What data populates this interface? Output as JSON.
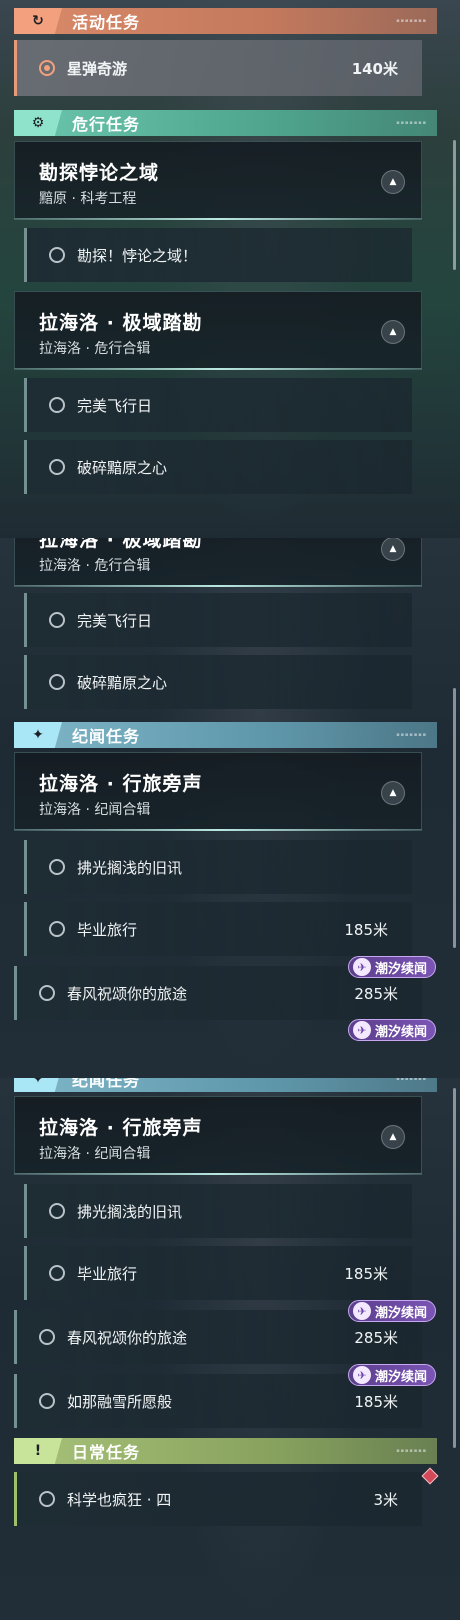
{
  "categories": {
    "event": "活动任务",
    "danger": "危行任务",
    "chronicle": "纪闻任务",
    "daily": "日常任务"
  },
  "icons": {
    "event": "event-quest-icon",
    "danger": "danger-quest-icon",
    "chronicle": "chronicle-quest-icon",
    "daily": "daily-quest-icon",
    "expand": "chevron-up-icon",
    "badge": "tide-chronicle-icon"
  },
  "colors": {
    "event": "#d98a68",
    "danger": "#6bc6ae",
    "chronicle": "#7fb7c9",
    "daily": "#a8c27a",
    "badge": "#7b55b5"
  },
  "event_task": {
    "name": "星弹奇游",
    "distance": "140米"
  },
  "groups": {
    "explore": {
      "title": "勘探悖论之域",
      "subtitle": "黯原 · 科考工程"
    },
    "laheluo_danger": {
      "title": "拉海洛 · 极域踏勘",
      "subtitle": "拉海洛 · 危行合辑"
    },
    "laheluo_chron": {
      "title": "拉海洛 · 行旅旁声",
      "subtitle": "拉海洛 · 纪闻合辑"
    }
  },
  "tasks": {
    "explore_1": "勘探！悖论之域！",
    "flight": "完美飞行日",
    "heart": "破碎黯原之心",
    "rumor": "拂光搁浅的旧讯",
    "graduation": {
      "name": "毕业旅行",
      "distance": "185米"
    },
    "spring": {
      "name": "春风祝颂你的旅途",
      "distance": "285米"
    },
    "snow": {
      "name": "如那融雪所愿般",
      "distance": "185米"
    },
    "daily_science": {
      "name": "科学也疯狂 · 四",
      "distance": "3米"
    }
  },
  "badge_label": "潮汐续闻"
}
